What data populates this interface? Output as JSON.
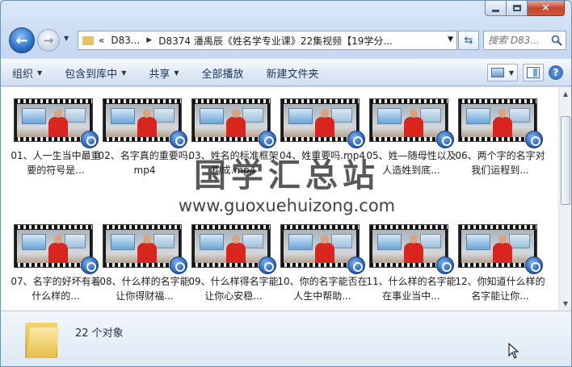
{
  "window": {
    "caption_icons": [
      "minimize-icon",
      "maximize-icon",
      "close-icon"
    ]
  },
  "nav": {
    "back_glyph": "←",
    "forward_glyph": "→",
    "address": {
      "overflow": "«",
      "crumbs": [
        "D83...",
        "D8374 潘禹辰《姓名学专业课》22集视频【19学分..."
      ]
    },
    "search_placeholder": "搜索 D83..."
  },
  "toolbar": {
    "organize": "组织",
    "include_library": "包含到库中",
    "share": "共享",
    "play_all": "全部播放",
    "new_folder": "新建文件夹"
  },
  "files": [
    {
      "name": "01、人一生当中最重要的符号是..."
    },
    {
      "name": "02、名字真的重要吗.mp4"
    },
    {
      "name": "03、姓名的标准框架构成.mp4"
    },
    {
      "name": "04、姓重要吗.mp4"
    },
    {
      "name": "05、姓—随母性以及人造姓到底..."
    },
    {
      "name": "06、两个字的名字对我们运程到..."
    },
    {
      "name": "07、名字的好坏有着什么样的..."
    },
    {
      "name": "08、什么样的名字能让你得财福..."
    },
    {
      "name": "09、什么样得名字能让你心安稳..."
    },
    {
      "name": "10、你的名字能否在人生中帮助..."
    },
    {
      "name": "11、什么样的名字能在事业当中..."
    },
    {
      "name": "12、你知道什么样的名字能让你..."
    }
  ],
  "watermark": {
    "title": "国学汇总站",
    "url": "www.guoxuehuizong.com"
  },
  "status": {
    "count": "22 个对象"
  },
  "colors": {
    "accent": "#2a6fc8",
    "shirt": "#d8261f",
    "folder": "#e8bd48"
  }
}
